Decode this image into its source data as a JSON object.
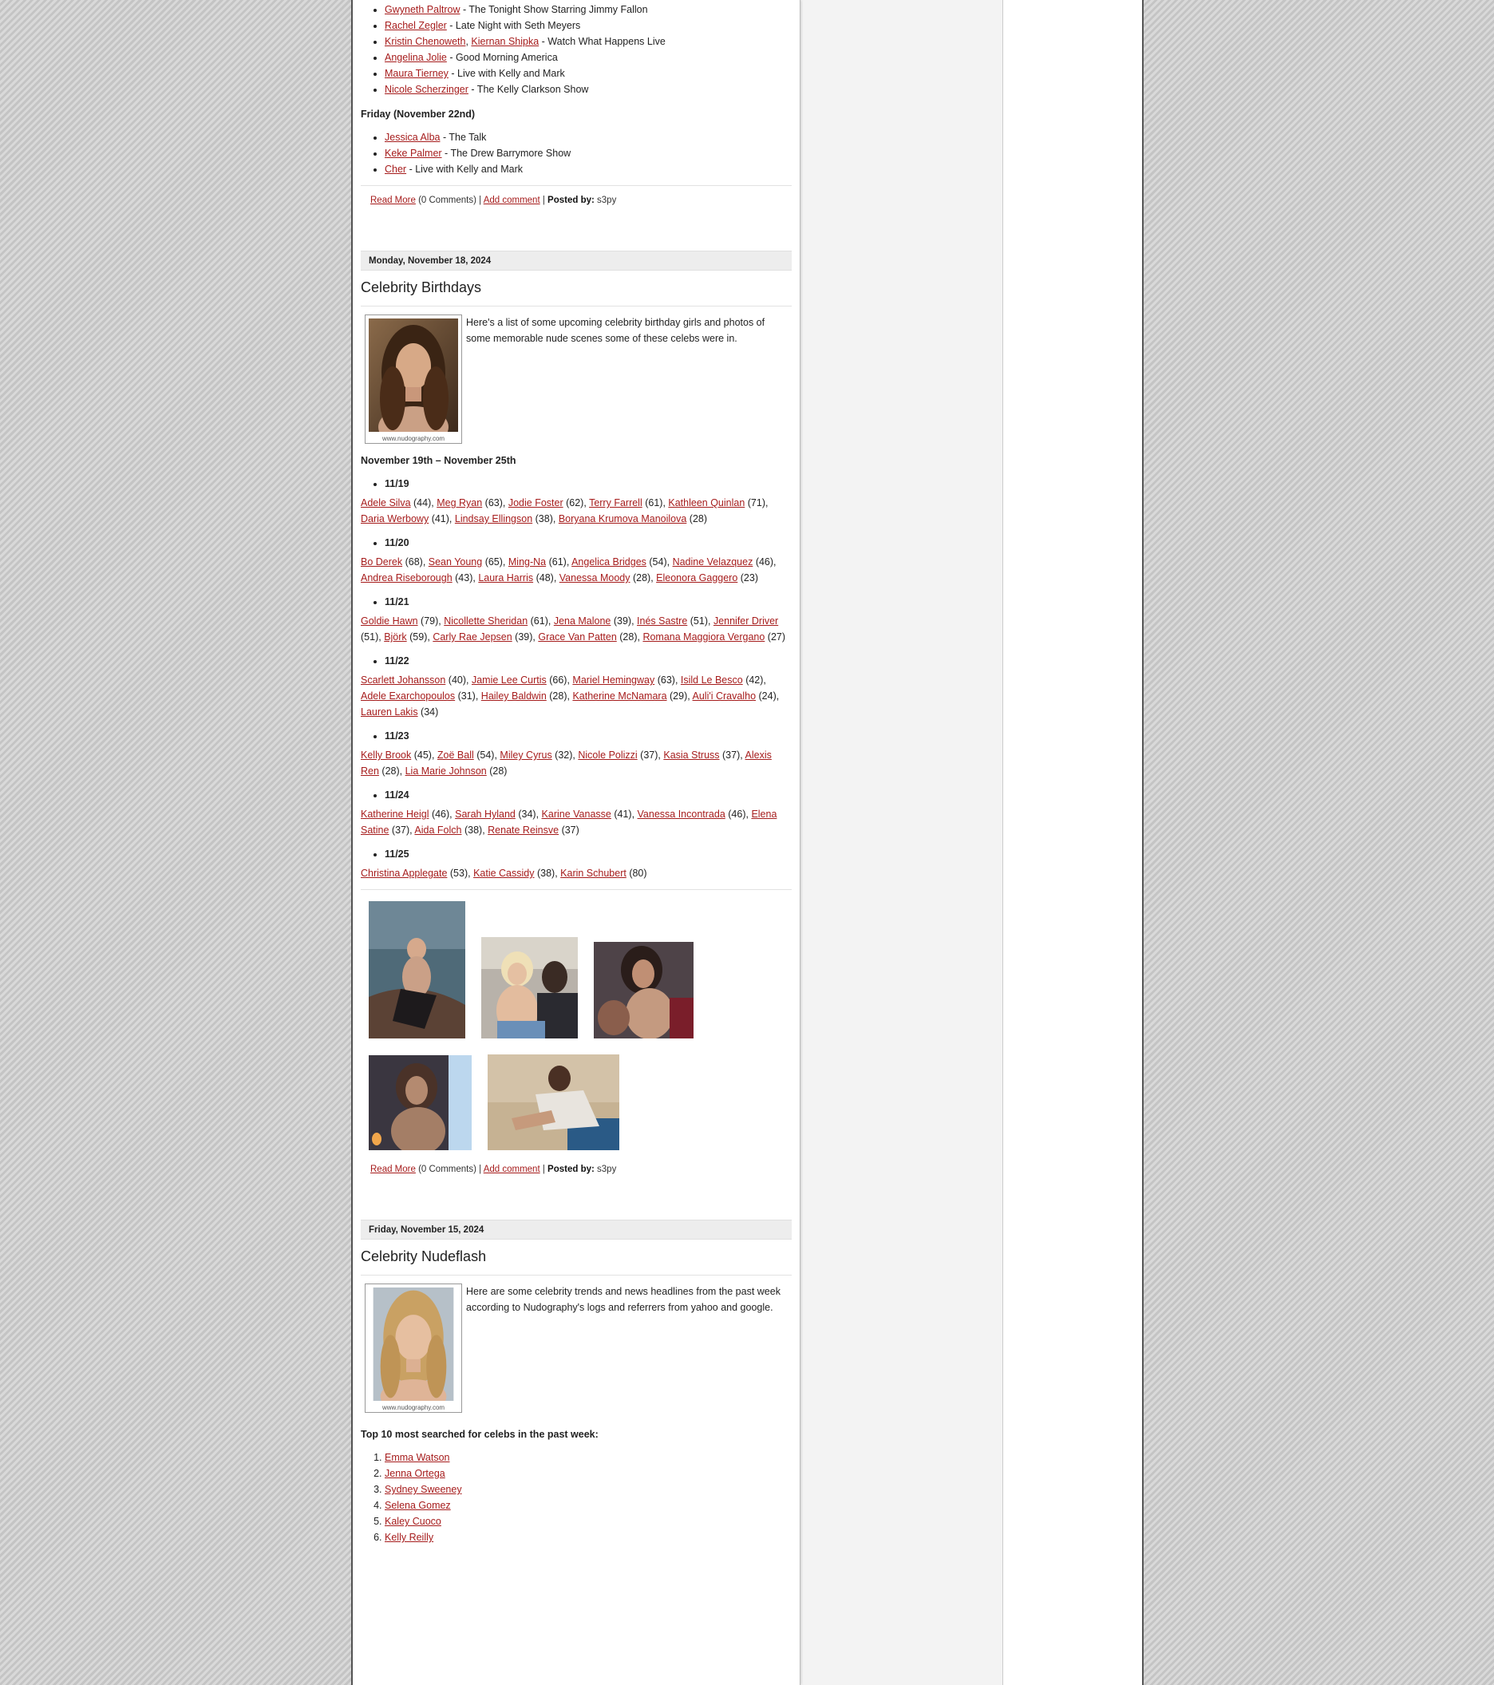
{
  "top_schedule": {
    "thursday_items": [
      {
        "links": [
          "Gwyneth Paltrow"
        ],
        "show": " - The Tonight Show Starring Jimmy Fallon"
      },
      {
        "links": [
          "Rachel Zegler"
        ],
        "show": " - Late Night with Seth Meyers"
      },
      {
        "links": [
          "Kristin Chenoweth",
          "Kiernan Shipka"
        ],
        "show": " - Watch What Happens Live"
      },
      {
        "links": [
          "Angelina Jolie"
        ],
        "show": " - Good Morning America"
      },
      {
        "links": [
          "Maura Tierney"
        ],
        "show": " - Live with Kelly and Mark"
      },
      {
        "links": [
          "Nicole Scherzinger"
        ],
        "show": " - The Kelly Clarkson Show"
      }
    ],
    "friday_heading": "Friday (November 22nd)",
    "friday_items": [
      {
        "links": [
          "Jessica Alba"
        ],
        "show": " - The Talk"
      },
      {
        "links": [
          "Keke Palmer"
        ],
        "show": " - The Drew Barrymore Show"
      },
      {
        "links": [
          "Cher"
        ],
        "show": " - Live with Kelly and Mark"
      }
    ]
  },
  "post_meta": {
    "read_more": "Read More",
    "comments": " (0 Comments) | ",
    "add_comment": "Add comment",
    "posted_by_label": "Posted by:",
    "author": "s3py"
  },
  "post_birthdays": {
    "date": "Monday, November 18, 2024",
    "title": "Celebrity Birthdays",
    "intro": "Here's a list of some upcoming celebrity birthday girls and photos of some memorable nude scenes some of these celebs were in.",
    "thumb_caption": "www.nudography.com",
    "range_heading": "November 19th – November 25th",
    "days": [
      {
        "day": "11/19",
        "celebs": [
          [
            "Adele Silva",
            "44"
          ],
          [
            "Meg Ryan",
            "63"
          ],
          [
            "Jodie Foster",
            "62"
          ],
          [
            "Terry Farrell",
            "61"
          ],
          [
            "Kathleen Quinlan",
            "71"
          ],
          [
            "Daria Werbowy",
            "41"
          ],
          [
            "Lindsay Ellingson",
            "38"
          ],
          [
            "Boryana Krumova Manoilova",
            "28"
          ]
        ]
      },
      {
        "day": "11/20",
        "celebs": [
          [
            "Bo Derek",
            "68"
          ],
          [
            "Sean Young",
            "65"
          ],
          [
            "Ming-Na",
            "61"
          ],
          [
            "Angelica Bridges",
            "54"
          ],
          [
            "Nadine Velazquez",
            "46"
          ],
          [
            "Andrea Riseborough",
            "43"
          ],
          [
            "Laura Harris",
            "48"
          ],
          [
            "Vanessa Moody",
            "28"
          ],
          [
            "Eleonora Gaggero",
            "23"
          ]
        ]
      },
      {
        "day": "11/21",
        "celebs": [
          [
            "Goldie Hawn",
            "79"
          ],
          [
            "Nicollette Sheridan",
            "61"
          ],
          [
            "Jena Malone",
            "39"
          ],
          [
            "Inés Sastre",
            "51"
          ],
          [
            "Jennifer Driver",
            "51"
          ],
          [
            "Björk",
            "59"
          ],
          [
            "Carly Rae Jepsen",
            "39"
          ],
          [
            "Grace Van Patten",
            "28"
          ],
          [
            "Romana Maggiora Vergano",
            "27"
          ]
        ]
      },
      {
        "day": "11/22",
        "celebs": [
          [
            "Scarlett Johansson",
            "40"
          ],
          [
            "Jamie Lee Curtis",
            "66"
          ],
          [
            "Mariel Hemingway",
            "63"
          ],
          [
            "Isild Le Besco",
            "42"
          ],
          [
            "Adele Exarchopoulos",
            "31"
          ],
          [
            "Hailey Baldwin",
            "28"
          ],
          [
            "Katherine McNamara",
            "29"
          ],
          [
            "Auli'i Cravalho",
            "24"
          ],
          [
            "Lauren Lakis",
            "34"
          ]
        ]
      },
      {
        "day": "11/23",
        "celebs": [
          [
            "Kelly Brook",
            "45"
          ],
          [
            "Zoë Ball",
            "54"
          ],
          [
            "Miley Cyrus",
            "32"
          ],
          [
            "Nicole Polizzi",
            "37"
          ],
          [
            "Kasia Struss",
            "37"
          ],
          [
            "Alexis Ren",
            "28"
          ],
          [
            "Lia Marie Johnson",
            "28"
          ]
        ]
      },
      {
        "day": "11/24",
        "celebs": [
          [
            "Katherine Heigl",
            "46"
          ],
          [
            "Sarah Hyland",
            "34"
          ],
          [
            "Karine Vanasse",
            "41"
          ],
          [
            "Vanessa Incontrada",
            "46"
          ],
          [
            "Elena Satine",
            "37"
          ],
          [
            "Aida Folch",
            "38"
          ],
          [
            "Renate Reinsve",
            "37"
          ]
        ]
      },
      {
        "day": "11/25",
        "celebs": [
          [
            "Christina Applegate",
            "53"
          ],
          [
            "Katie Cassidy",
            "38"
          ],
          [
            "Karin Schubert",
            "80"
          ]
        ]
      }
    ]
  },
  "post_nudeflash": {
    "date": "Friday, November 15, 2024",
    "title": "Celebrity Nudeflash",
    "intro": "Here are some celebrity trends and news headlines from the past week according to Nudography's logs and referrers from yahoo and google.",
    "thumb_caption": "www.nudography.com",
    "top_heading": "Top 10 most searched for celebs in the past week:",
    "top_list": [
      "Emma Watson",
      "Jenna Ortega",
      "Sydney Sweeney",
      "Selena Gomez",
      "Kaley Cuoco",
      "Kelly Reilly"
    ]
  },
  "colors": {
    "link": "#a61c1c",
    "date_bar": "#ededed",
    "page_bg": "#f3f3f3"
  }
}
